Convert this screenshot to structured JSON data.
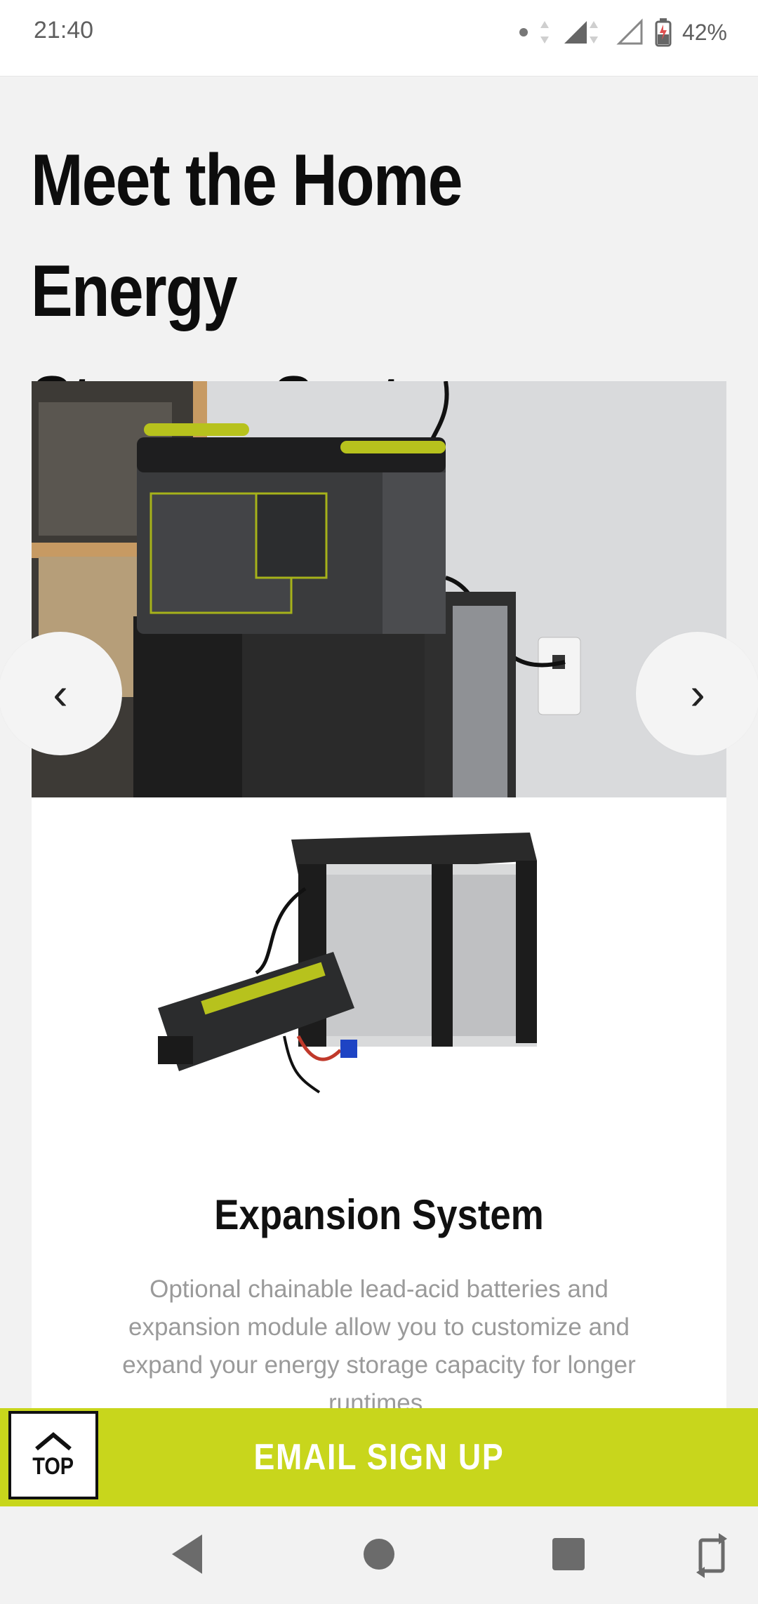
{
  "status_bar": {
    "time": "21:40",
    "battery": "42%"
  },
  "page": {
    "headline_line1": "Meet the Home Energy",
    "headline_line2": "Storage System"
  },
  "carousel": {
    "prev_label": "‹",
    "next_label": "›",
    "image_alt": "Yeti power station on expansion batteries beside wall outlet"
  },
  "card": {
    "title": "Expansion System",
    "description": "Optional chainable lead-acid batteries and expansion module allow you to customize and expand your energy storage capacity for longer runtimes."
  },
  "bottom_bar": {
    "top_label": "TOP",
    "signup_label": "EMAIL SIGN UP"
  },
  "colors": {
    "accent": "#c8d61c",
    "headline": "#0d0d0d",
    "muted_text": "#9a9a9a"
  }
}
